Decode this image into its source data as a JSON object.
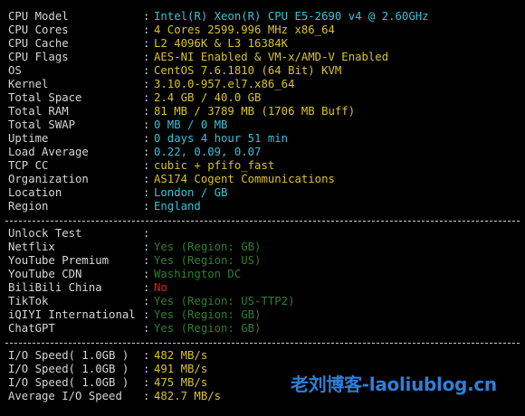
{
  "colors": {
    "background": "#000000",
    "label": "#d6d6d6",
    "value_cyan": "#36c3d6",
    "value_gold": "#d9c12a",
    "value_yes": "#2e7f2e",
    "value_no": "#e02020",
    "watermark": "#2f7fd6"
  },
  "system_info": [
    {
      "label": "CPU Model",
      "sep": ":",
      "value": "Intel(R) Xeon(R) CPU E5-2690 v4 @ 2.60GHz",
      "color": "#36c3d6"
    },
    {
      "label": "CPU Cores",
      "sep": ":",
      "value": "4 Cores 2599.996 MHz x86_64",
      "color": "#d9c12a"
    },
    {
      "label": "CPU Cache",
      "sep": ":",
      "value": "L2 4096K & L3 16384K",
      "color": "#d9c12a"
    },
    {
      "label": "CPU Flags",
      "sep": ":",
      "value": "AES-NI Enabled & VM-x/AMD-V Enabled",
      "color": "#d9c12a"
    },
    {
      "label": "OS",
      "sep": ":",
      "value": "CentOS 7.6.1810 (64 Bit) KVM",
      "color": "#d9c12a"
    },
    {
      "label": "Kernel",
      "sep": ":",
      "value": "3.10.0-957.el7.x86_64",
      "color": "#d9c12a"
    },
    {
      "label": "Total Space",
      "sep": ":",
      "value": "2.4 GB / 40.0 GB",
      "color": "#d9c12a"
    },
    {
      "label": "Total RAM",
      "sep": ":",
      "value": "81 MB / 3789 MB (1706 MB Buff)",
      "color": "#d9c12a"
    },
    {
      "label": "Total SWAP",
      "sep": ":",
      "value": "0 MB / 0 MB",
      "color": "#36c3d6"
    },
    {
      "label": "Uptime",
      "sep": ":",
      "value": "0 days 4 hour 51 min",
      "color": "#36c3d6"
    },
    {
      "label": "Load Average",
      "sep": ":",
      "value": "0.22, 0.09, 0.07",
      "color": "#36c3d6"
    },
    {
      "label": "TCP CC",
      "sep": ":",
      "value": "cubic + pfifo_fast",
      "color": "#d9c12a"
    },
    {
      "label": "Organization",
      "sep": ":",
      "value": "AS174 Cogent Communications",
      "color": "#d9c12a"
    },
    {
      "label": "Location",
      "sep": ":",
      "value": "London / GB",
      "color": "#36c3d6"
    },
    {
      "label": "Region",
      "sep": ":",
      "value": "England",
      "color": "#36c3d6"
    }
  ],
  "unlock_test": [
    {
      "label": "Unlock Test",
      "sep": ":",
      "value": "",
      "color": "#2e7f2e"
    },
    {
      "label": "Netflix",
      "sep": ":",
      "value": "Yes (Region: GB)",
      "color": "#2e7f2e"
    },
    {
      "label": "YouTube Premium",
      "sep": ":",
      "value": "Yes (Region: US)",
      "color": "#2e7f2e"
    },
    {
      "label": "YouTube CDN",
      "sep": ":",
      "value": "Washington DC",
      "color": "#2e7f2e"
    },
    {
      "label": "BiliBili China",
      "sep": ":",
      "value": "No",
      "color": "#e02020"
    },
    {
      "label": "TikTok",
      "sep": ":",
      "value": "Yes (Region: US-TTP2)",
      "color": "#2e7f2e"
    },
    {
      "label": "iQIYI International",
      "sep": ":",
      "value": "Yes (Region: GB)",
      "color": "#2e7f2e"
    },
    {
      "label": "ChatGPT",
      "sep": ":",
      "value": "Yes (Region: GB)",
      "color": "#2e7f2e"
    }
  ],
  "io_speed": [
    {
      "label": "I/O Speed( 1.0GB )",
      "sep": ":",
      "value": "482 MB/s",
      "color": "#d9c12a"
    },
    {
      "label": "I/O Speed( 1.0GB )",
      "sep": ":",
      "value": "491 MB/s",
      "color": "#d9c12a"
    },
    {
      "label": "I/O Speed( 1.0GB )",
      "sep": ":",
      "value": "475 MB/s",
      "color": "#d9c12a"
    },
    {
      "label": "Average I/O Speed",
      "sep": ":",
      "value": "482.7 MB/s",
      "color": "#d9c12a"
    }
  ],
  "watermark": {
    "text": "老刘博客-laoliublog.cn"
  }
}
